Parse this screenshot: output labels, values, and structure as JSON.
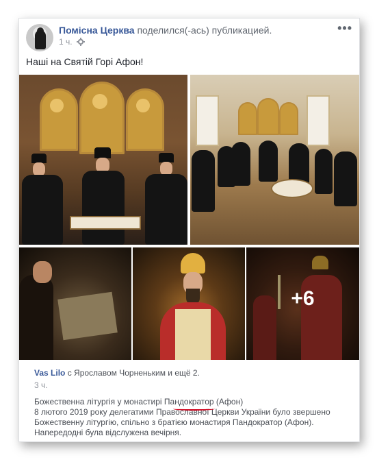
{
  "post": {
    "page_name": "Помісна Церква",
    "shared_text": "поделился(-ась) публикацией.",
    "time": "1 ч.",
    "more": "•••",
    "caption": "Наші на Святій Горі Афон!"
  },
  "gallery": {
    "more_count": "+6"
  },
  "shared": {
    "author": "Vas Lilo",
    "with_text": "с Ярославом Чорненьким и ещё 2.",
    "time": "3 ч.",
    "lines": [
      "Божественна літургія у монастирі Пандократор (Афон)",
      "8 лютого 2019 року делегатими Православної Церкви України було звершено",
      "Божественну літургію, спільно з братією монастиря Пандократор (Афон).",
      "Напередодні була відслужена вечірня."
    ]
  },
  "colors": {
    "link": "#385898",
    "muted": "#90949c",
    "underline": "#d0021b"
  }
}
